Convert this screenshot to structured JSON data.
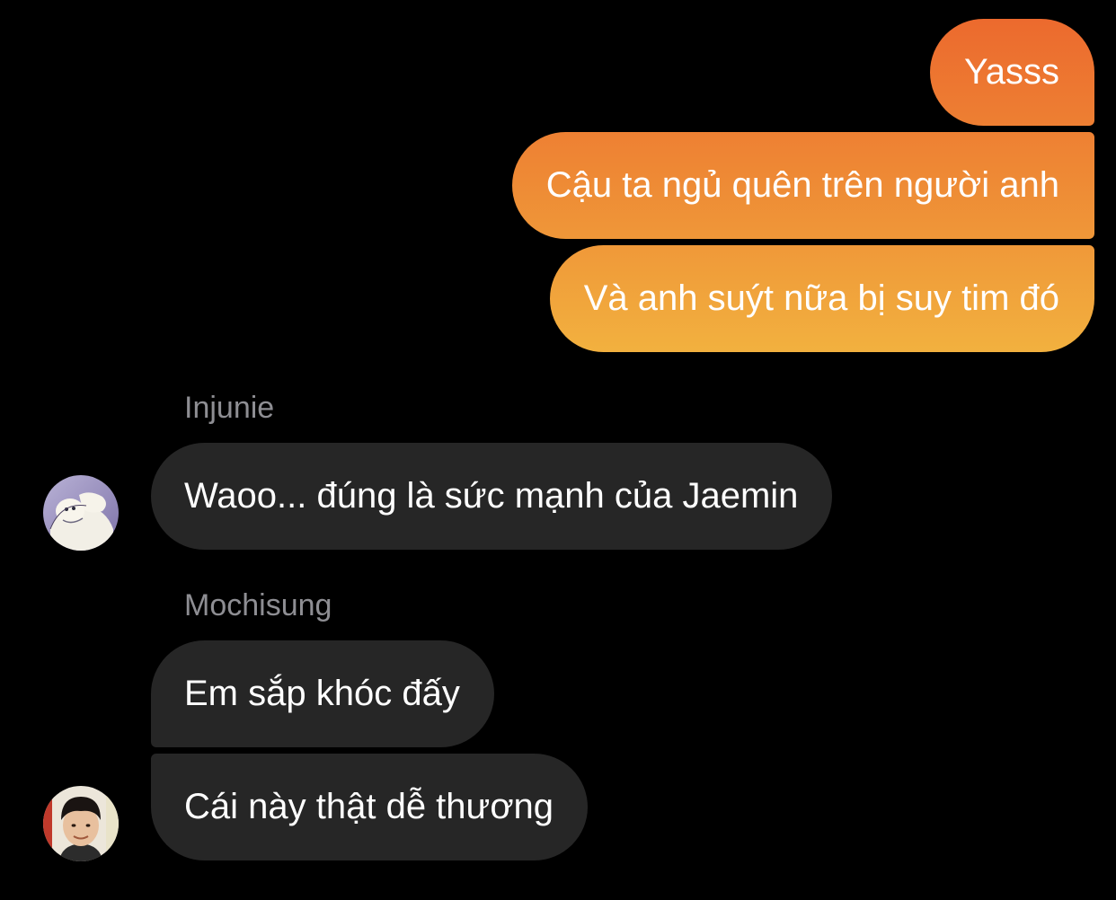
{
  "conversation": {
    "outgoing": [
      {
        "text": "Yasss"
      },
      {
        "text": "Cậu ta ngủ quên trên người anh"
      },
      {
        "text": "Và anh suýt nữa bị suy tim đó"
      }
    ],
    "groups": [
      {
        "sender": "Injunie",
        "avatar_icon": "moomin-avatar",
        "messages": [
          {
            "text": "Waoo... đúng là sức mạnh của Jaemin"
          }
        ]
      },
      {
        "sender": "Mochisung",
        "avatar_icon": "boy-photo-avatar",
        "messages": [
          {
            "text": "Em sắp khóc đấy"
          },
          {
            "text": "Cái này thật dễ thương"
          }
        ]
      }
    ]
  },
  "colors": {
    "background": "#000000",
    "outgoing_gradient_top": "#ec6a2e",
    "outgoing_gradient_bottom": "#f2b13f",
    "incoming_bubble": "#262626",
    "sender_name": "#8e8e93",
    "message_text": "#ffffff"
  }
}
